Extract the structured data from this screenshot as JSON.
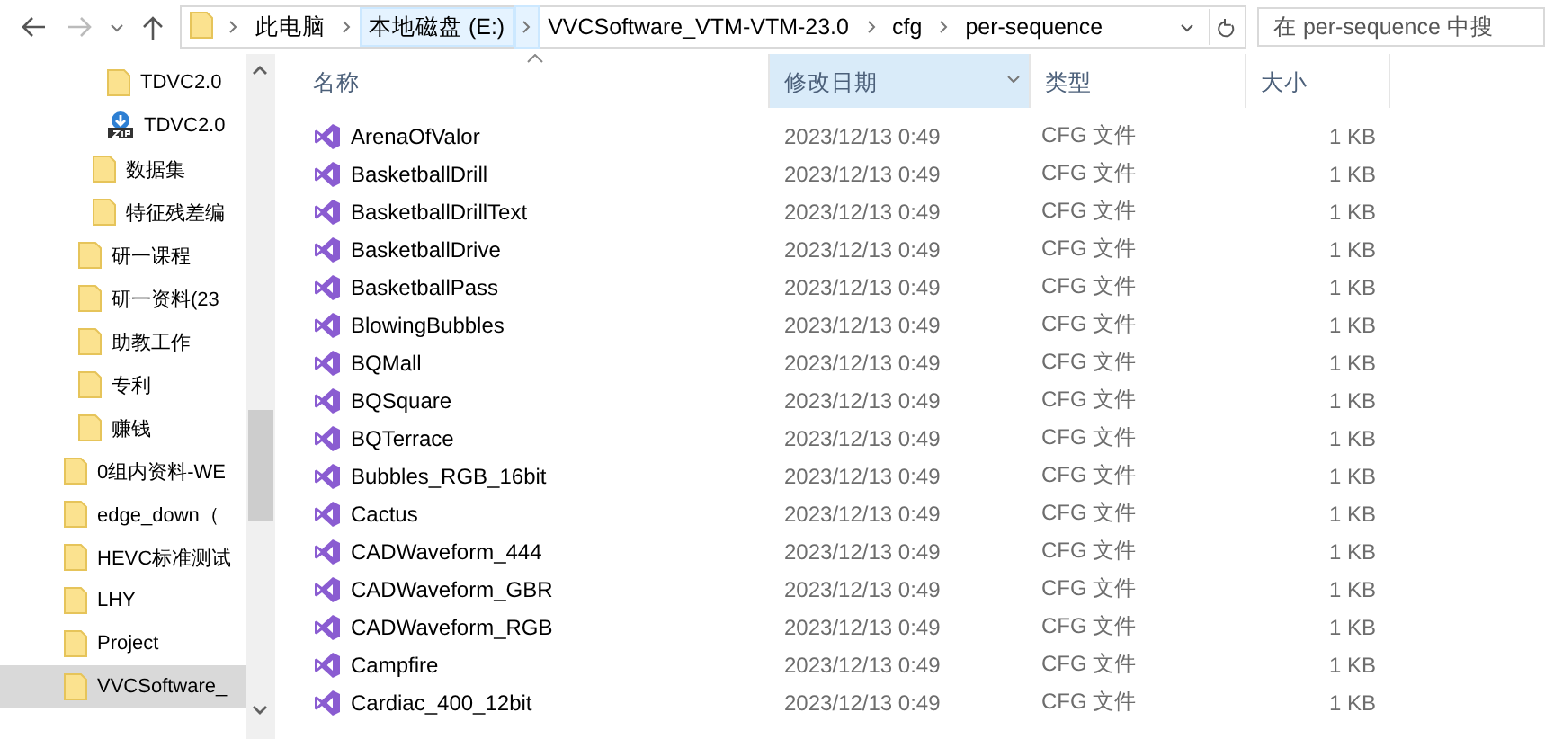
{
  "toolbar": {
    "back": {
      "disabled": false
    },
    "forward": {
      "disabled": true
    },
    "breadcrumbs": [
      {
        "label": "此电脑",
        "highlighted": false
      },
      {
        "label": "本地磁盘 (E:)",
        "highlighted": true
      },
      {
        "label": "VVCSoftware_VTM-VTM-23.0",
        "highlighted": false
      },
      {
        "label": "cfg",
        "highlighted": false
      },
      {
        "label": "per-sequence",
        "highlighted": false
      }
    ],
    "search": {
      "placeholder": "在 per-sequence 中搜"
    }
  },
  "sidebar": {
    "items": [
      {
        "children": [
          {
            "children": [
              {
                "children": [
                  {
                    "label": "TDVC2.0",
                    "kind": "folder",
                    "selected": false
                  },
                  {
                    "label": "TDVC2.0",
                    "kind": "zip",
                    "selected": false
                  }
                ]
              },
              {
                "label": "数据集",
                "kind": "folder",
                "selected": false
              },
              {
                "label": "特征残差编",
                "kind": "folder",
                "selected": false
              }
            ]
          },
          {
            "label": "研一课程",
            "kind": "folder",
            "selected": false
          },
          {
            "label": "研一资料(23",
            "kind": "folder",
            "selected": false
          },
          {
            "label": "助教工作",
            "kind": "folder",
            "selected": false
          },
          {
            "label": "专利",
            "kind": "folder",
            "selected": false
          },
          {
            "label": "赚钱",
            "kind": "folder",
            "selected": false
          }
        ]
      },
      {
        "label": "0组内资料-WE",
        "kind": "folder",
        "selected": false
      },
      {
        "label": "edge_down（",
        "kind": "folder",
        "selected": false
      },
      {
        "label": "HEVC标准测试",
        "kind": "folder",
        "selected": false
      },
      {
        "label": "LHY",
        "kind": "folder",
        "selected": false
      },
      {
        "label": "Project",
        "kind": "folder",
        "selected": false
      },
      {
        "label": "VVCSoftware_",
        "kind": "folder",
        "selected": true
      }
    ]
  },
  "table": {
    "columns": [
      {
        "label": "名称",
        "highlighted": false
      },
      {
        "label": "修改日期",
        "highlighted": true
      },
      {
        "label": "类型",
        "highlighted": false
      },
      {
        "label": "大小",
        "highlighted": false
      }
    ],
    "rows": [
      {
        "name": "ArenaOfValor",
        "date": "2023/12/13 0:49",
        "type": "CFG 文件",
        "size": "1 KB"
      },
      {
        "name": "BasketballDrill",
        "date": "2023/12/13 0:49",
        "type": "CFG 文件",
        "size": "1 KB"
      },
      {
        "name": "BasketballDrillText",
        "date": "2023/12/13 0:49",
        "type": "CFG 文件",
        "size": "1 KB"
      },
      {
        "name": "BasketballDrive",
        "date": "2023/12/13 0:49",
        "type": "CFG 文件",
        "size": "1 KB"
      },
      {
        "name": "BasketballPass",
        "date": "2023/12/13 0:49",
        "type": "CFG 文件",
        "size": "1 KB"
      },
      {
        "name": "BlowingBubbles",
        "date": "2023/12/13 0:49",
        "type": "CFG 文件",
        "size": "1 KB"
      },
      {
        "name": "BQMall",
        "date": "2023/12/13 0:49",
        "type": "CFG 文件",
        "size": "1 KB"
      },
      {
        "name": "BQSquare",
        "date": "2023/12/13 0:49",
        "type": "CFG 文件",
        "size": "1 KB"
      },
      {
        "name": "BQTerrace",
        "date": "2023/12/13 0:49",
        "type": "CFG 文件",
        "size": "1 KB"
      },
      {
        "name": "Bubbles_RGB_16bit",
        "date": "2023/12/13 0:49",
        "type": "CFG 文件",
        "size": "1 KB"
      },
      {
        "name": "Cactus",
        "date": "2023/12/13 0:49",
        "type": "CFG 文件",
        "size": "1 KB"
      },
      {
        "name": "CADWaveform_444",
        "date": "2023/12/13 0:49",
        "type": "CFG 文件",
        "size": "1 KB"
      },
      {
        "name": "CADWaveform_GBR",
        "date": "2023/12/13 0:49",
        "type": "CFG 文件",
        "size": "1 KB"
      },
      {
        "name": "CADWaveform_RGB",
        "date": "2023/12/13 0:49",
        "type": "CFG 文件",
        "size": "1 KB"
      },
      {
        "name": "Campfire",
        "date": "2023/12/13 0:49",
        "type": "CFG 文件",
        "size": "1 KB"
      },
      {
        "name": "Cardiac_400_12bit",
        "date": "2023/12/13 0:49",
        "type": "CFG 文件",
        "size": "1 KB"
      }
    ]
  }
}
